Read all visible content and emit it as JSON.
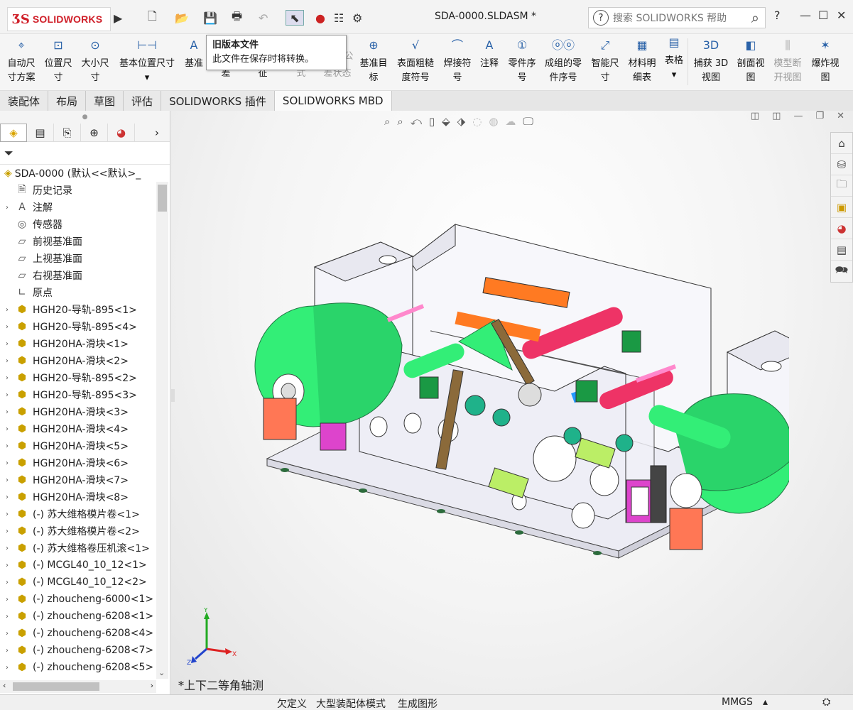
{
  "app": {
    "logo_text": "SOLIDWORKS",
    "document_title": "SDA-0000.SLDASM *",
    "search_placeholder": "搜索 SOLIDWORKS 帮助"
  },
  "tooltip": {
    "title": "旧版本文件",
    "body": "此文件在保存时将转换。"
  },
  "commands": [
    {
      "label1": "自动尺",
      "label2": "寸方案",
      "icon": "auto-dimension-icon"
    },
    {
      "label1": "位置尺",
      "label2": "寸",
      "icon": "location-dimension-icon"
    },
    {
      "label1": "大小尺",
      "label2": "寸",
      "icon": "size-dimension-icon"
    },
    {
      "label1": "基本位置尺寸",
      "label2": "",
      "icon": "basic-location-dimension-icon"
    },
    {
      "label1": "基准",
      "label2": "",
      "icon": "datum-icon"
    },
    {
      "label1": "",
      "label2": "差",
      "icon": "tolerance-icon"
    },
    {
      "label1": "",
      "label2": "征",
      "icon": "feature-icon"
    },
    {
      "label1": "",
      "label2": "式",
      "icon": "pattern-icon"
    },
    {
      "label1": "公",
      "label2": "差状态",
      "icon": "tolerance-status-icon"
    },
    {
      "label1": "基准目",
      "label2": "标",
      "icon": "datum-target-icon"
    },
    {
      "label1": "表面粗糙",
      "label2": "度符号",
      "icon": "surface-finish-icon"
    },
    {
      "label1": "焊接符",
      "label2": "号",
      "icon": "weld-symbol-icon"
    },
    {
      "label1": "注释",
      "label2": "",
      "icon": "note-icon"
    },
    {
      "label1": "零件序",
      "label2": "号",
      "icon": "balloon-icon"
    },
    {
      "label1": "成组的零",
      "label2": "件序号",
      "icon": "stacked-balloon-icon"
    },
    {
      "label1": "智能尺",
      "label2": "寸",
      "icon": "smart-dimension-icon"
    },
    {
      "label1": "材料明",
      "label2": "细表",
      "icon": "bom-icon"
    },
    {
      "label1": "表格",
      "label2": "",
      "icon": "table-icon"
    },
    {
      "label1": "捕获 3D",
      "label2": "视图",
      "icon": "capture-3d-view-icon"
    },
    {
      "label1": "剖面视",
      "label2": "图",
      "icon": "section-view-icon"
    },
    {
      "label1": "模型断",
      "label2": "开视图",
      "icon": "model-break-view-icon"
    },
    {
      "label1": "爆炸视",
      "label2": "图",
      "icon": "explode-view-icon"
    }
  ],
  "tabs": [
    "装配体",
    "布局",
    "草图",
    "评估",
    "SOLIDWORKS 插件",
    "SOLIDWORKS MBD"
  ],
  "tree": {
    "root": "SDA-0000  (默认<<默认>_",
    "items": [
      {
        "label": "历史记录",
        "expand": false,
        "type": "feat",
        "icon": "history-icon"
      },
      {
        "label": "注解",
        "expand": true,
        "type": "feat",
        "icon": "annotation-icon"
      },
      {
        "label": "传感器",
        "expand": false,
        "type": "feat",
        "icon": "sensor-icon"
      },
      {
        "label": "前视基准面",
        "expand": false,
        "type": "feat",
        "icon": "plane-icon"
      },
      {
        "label": "上视基准面",
        "expand": false,
        "type": "feat",
        "icon": "plane-icon"
      },
      {
        "label": "右视基准面",
        "expand": false,
        "type": "feat",
        "icon": "plane-icon"
      },
      {
        "label": "原点",
        "expand": false,
        "type": "feat",
        "icon": "origin-icon"
      },
      {
        "label": "HGH20-导轨-895<1>",
        "expand": true,
        "type": "part",
        "icon": "part-icon"
      },
      {
        "label": "HGH20-导轨-895<4>",
        "expand": true,
        "type": "part",
        "icon": "part-icon"
      },
      {
        "label": "HGH20HA-滑块<1>",
        "expand": true,
        "type": "part",
        "icon": "part-icon"
      },
      {
        "label": "HGH20HA-滑块<2>",
        "expand": true,
        "type": "part",
        "icon": "part-icon"
      },
      {
        "label": "HGH20-导轨-895<2>",
        "expand": true,
        "type": "part",
        "icon": "part-icon"
      },
      {
        "label": "HGH20-导轨-895<3>",
        "expand": true,
        "type": "part",
        "icon": "part-icon"
      },
      {
        "label": "HGH20HA-滑块<3>",
        "expand": true,
        "type": "part",
        "icon": "part-icon"
      },
      {
        "label": "HGH20HA-滑块<4>",
        "expand": true,
        "type": "part",
        "icon": "part-icon"
      },
      {
        "label": "HGH20HA-滑块<5>",
        "expand": true,
        "type": "part",
        "icon": "part-icon"
      },
      {
        "label": "HGH20HA-滑块<6>",
        "expand": true,
        "type": "part",
        "icon": "part-icon"
      },
      {
        "label": "HGH20HA-滑块<7>",
        "expand": true,
        "type": "part",
        "icon": "part-icon"
      },
      {
        "label": "HGH20HA-滑块<8>",
        "expand": true,
        "type": "part",
        "icon": "part-icon"
      },
      {
        "label": "(-) 苏大维格模片卷<1>",
        "expand": true,
        "type": "part",
        "icon": "part-icon"
      },
      {
        "label": "(-) 苏大维格模片卷<2>",
        "expand": true,
        "type": "part",
        "icon": "part-icon"
      },
      {
        "label": "(-) 苏大维格卷压机滚<1>",
        "expand": true,
        "type": "part",
        "icon": "part-icon"
      },
      {
        "label": "(-) MCGL40_10_12<1>",
        "expand": true,
        "type": "part",
        "icon": "part-icon"
      },
      {
        "label": "(-) MCGL40_10_12<2>",
        "expand": true,
        "type": "part",
        "icon": "part-icon"
      },
      {
        "label": "(-) zhoucheng-6000<1>",
        "expand": true,
        "type": "part",
        "icon": "part-icon"
      },
      {
        "label": "(-) zhoucheng-6208<1>",
        "expand": true,
        "type": "part",
        "icon": "part-icon"
      },
      {
        "label": "(-) zhoucheng-6208<4>",
        "expand": true,
        "type": "part",
        "icon": "part-icon"
      },
      {
        "label": "(-) zhoucheng-6208<7>",
        "expand": true,
        "type": "part",
        "icon": "part-icon"
      },
      {
        "label": "(-) zhoucheng-6208<5>",
        "expand": true,
        "type": "part",
        "icon": "part-icon"
      }
    ]
  },
  "viewport": {
    "view_name": "*上下二等角轴测",
    "triad": {
      "x": "X",
      "y": "Y",
      "z": "Z"
    }
  },
  "status": {
    "definition": "欠定义",
    "mode": "大型装配体模式",
    "regen": "生成图形",
    "units": "MMGS"
  },
  "colors": {
    "brand": "#d0202a",
    "model_green": "#33ee77",
    "model_pink": "#ee3366",
    "model_orange": "#ff7a22"
  }
}
